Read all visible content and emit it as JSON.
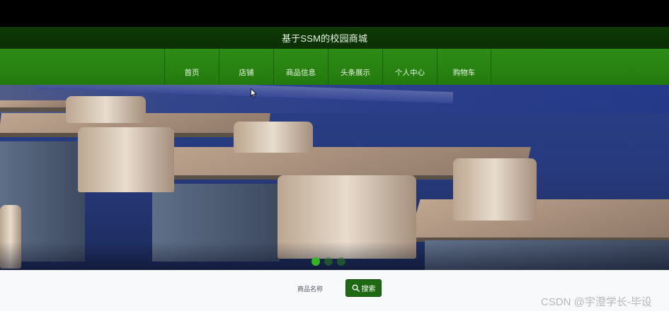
{
  "header": {
    "site_title": "基于SSM的校园商城"
  },
  "nav": {
    "items": [
      {
        "label": "首页"
      },
      {
        "label": "店铺"
      },
      {
        "label": "商品信息"
      },
      {
        "label": "头条展示"
      },
      {
        "label": "个人中心"
      },
      {
        "label": "购物车"
      }
    ]
  },
  "carousel": {
    "slide_count": 3,
    "active_index": 0
  },
  "search": {
    "label": "商品名称",
    "button_label": "搜索",
    "button_icon": "search-icon"
  },
  "watermark": {
    "text": "CSDN @宇澄学长-毕设"
  },
  "colors": {
    "nav_green": "#2e8d16",
    "title_bar": "#0e3a05",
    "button_green": "#1e6a14"
  }
}
